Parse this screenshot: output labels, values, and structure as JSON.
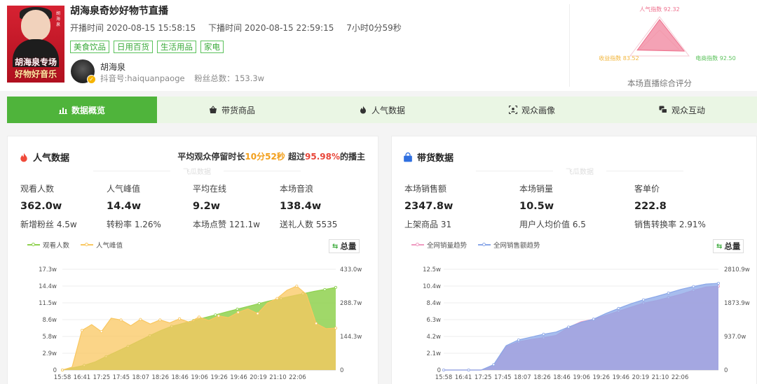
{
  "header": {
    "title": "胡海泉奇妙好物节直播",
    "start_label": "开播时间 2020-08-15 15:58:15",
    "end_label": "下播时间 2020-08-15 22:59:15",
    "duration": "7小时0分59秒",
    "tags": [
      "美食饮品",
      "日用百货",
      "生活用品",
      "家电"
    ],
    "cover_text_1": "胡海泉专场",
    "cover_text_2": "好物好音乐",
    "cover_side_text": "胡海泉",
    "streamer_name": "胡海泉",
    "douyin_id": "抖音号:haiquanpaoge",
    "fans": "粉丝总数：153.3w"
  },
  "radar": {
    "label_top": "人气指数 92.32",
    "label_left": "收益指数 83.52",
    "label_right": "电商指数 92.50",
    "values": [
      92.32,
      92.5,
      83.52
    ],
    "max": 100,
    "color": "#f0839c",
    "caption": "本场直播综合评分"
  },
  "tabs": [
    {
      "label": "数据概览",
      "icon": "bar-chart-icon",
      "active": true
    },
    {
      "label": "带货商品",
      "icon": "shopping-basket-icon",
      "active": false
    },
    {
      "label": "人气数据",
      "icon": "flame-icon",
      "active": false
    },
    {
      "label": "观众画像",
      "icon": "user-portrait-icon",
      "active": false
    },
    {
      "label": "观众互动",
      "icon": "chat-icon",
      "active": false
    }
  ],
  "popularity": {
    "title": "人气数据",
    "stay_prefix": "平均观众停留时长",
    "stay_value": "10分52秒",
    "stay_mid": " 超过",
    "stay_percent": "95.98%",
    "stay_suffix": "的播主",
    "watermark": "飞瓜数据",
    "metrics": [
      {
        "label": "观看人数",
        "value": "362.0w",
        "sub": "新增粉丝 4.5w"
      },
      {
        "label": "人气峰值",
        "value": "14.4w",
        "sub": "转粉率 1.26%"
      },
      {
        "label": "平均在线",
        "value": "9.2w",
        "sub": "本场点赞 121.1w"
      },
      {
        "label": "本场音浪",
        "value": "138.4w",
        "sub": "送礼人数 5535"
      }
    ],
    "legend": [
      "观看人数",
      "人气峰值"
    ],
    "total_label": "总量"
  },
  "sales": {
    "title": "带货数据",
    "watermark": "飞瓜数据",
    "metrics": [
      {
        "label": "本场销售额",
        "value": "2347.8w",
        "sub": "上架商品 31"
      },
      {
        "label": "本场销量",
        "value": "10.5w",
        "sub": "用户人均价值 6.5"
      },
      {
        "label": "客单价",
        "value": "222.8",
        "sub": "销售转换率 2.91%"
      }
    ],
    "legend": [
      "全网销量趋势",
      "全网销售额趋势"
    ],
    "total_label": "总量"
  },
  "chart_data": [
    {
      "type": "area",
      "title": "",
      "x": [
        "15:58",
        "16:41",
        "17:25",
        "17:45",
        "18:07",
        "18:26",
        "18:46",
        "19:06",
        "19:26",
        "19:46",
        "20:19",
        "21:10",
        "22:06"
      ],
      "y_left_ticks": [
        "0",
        "2.9w",
        "5.8w",
        "8.6w",
        "11.5w",
        "14.4w",
        "17.3w"
      ],
      "y_right_ticks": [
        "0",
        "144.3w",
        "288.7w",
        "433.0w"
      ],
      "y_left_range": [
        0,
        17.3
      ],
      "y_right_range": [
        0,
        433.0
      ],
      "series": [
        {
          "name": "观看人数",
          "axis": "right",
          "color": "#8fd14f",
          "values": [
            0,
            10,
            20,
            35,
            58,
            80,
            102,
            125,
            148,
            170,
            188,
            200,
            213,
            225,
            237,
            250,
            262,
            274,
            286,
            298,
            308,
            318,
            328,
            338,
            346,
            355
          ]
        },
        {
          "name": "人气峰值",
          "axis": "left",
          "color": "#f9c760",
          "values": [
            0,
            0.5,
            6.8,
            7.8,
            6.6,
            8.9,
            8.6,
            7.6,
            8.7,
            7.9,
            8.6,
            8.1,
            8.8,
            8.2,
            9.1,
            8.5,
            9.3,
            9.0,
            9.9,
            10.5,
            9.7,
            11.5,
            12.3,
            13.7,
            14.4,
            13.0,
            8.0,
            7.1,
            7.2
          ]
        }
      ]
    },
    {
      "type": "area",
      "title": "",
      "x": [
        "15:58",
        "16:41",
        "17:25",
        "17:45",
        "18:07",
        "18:26",
        "18:46",
        "19:06",
        "19:26",
        "19:46",
        "20:19",
        "21:10",
        "22:06"
      ],
      "y_left_ticks": [
        "0",
        "2.1w",
        "4.2w",
        "6.3w",
        "8.4w",
        "10.4w",
        "12.5w"
      ],
      "y_right_ticks": [
        "0",
        "937.0w",
        "1873.9w",
        "2810.9w"
      ],
      "y_left_range": [
        0,
        12.5
      ],
      "y_right_range": [
        0,
        2810.9
      ],
      "series": [
        {
          "name": "全网销量趋势",
          "axis": "left",
          "color": "#ef9ac1",
          "values": [
            0,
            0,
            0,
            0,
            0.6,
            2.9,
            3.5,
            3.8,
            4.0,
            4.3,
            5.3,
            6.0,
            6.3,
            6.8,
            7.3,
            7.8,
            8.3,
            8.6,
            9.0,
            9.4,
            9.9,
            10.3,
            10.4
          ]
        },
        {
          "name": "全网销售额趋势",
          "axis": "right",
          "color": "#8aa7e8",
          "values": [
            0,
            0,
            0,
            0,
            150,
            680,
            840,
            920,
            1000,
            1060,
            1200,
            1330,
            1420,
            1580,
            1720,
            1850,
            1960,
            2050,
            2150,
            2250,
            2330,
            2400,
            2420
          ]
        }
      ]
    }
  ]
}
